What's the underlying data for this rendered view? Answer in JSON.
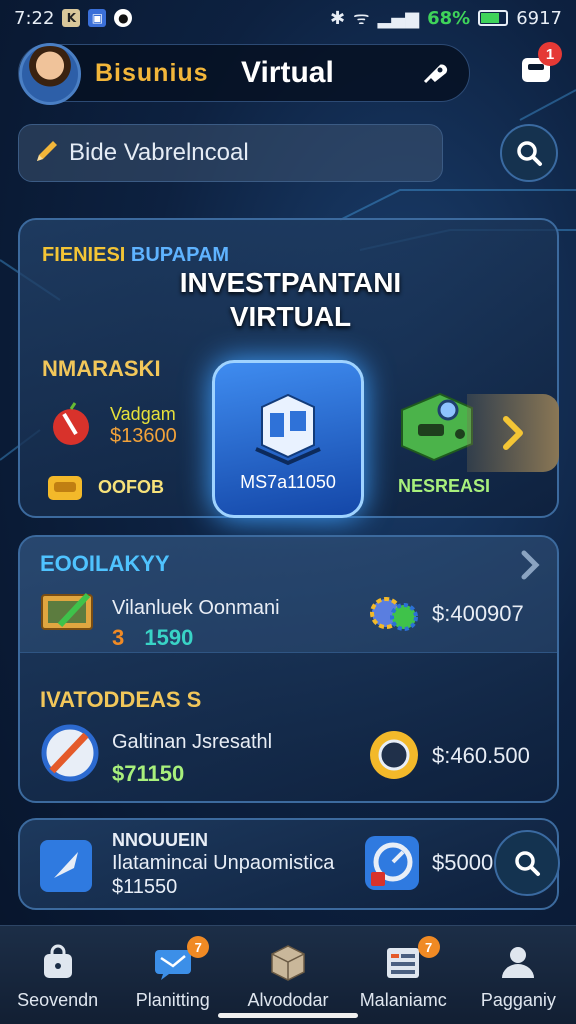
{
  "status": {
    "time": "7:22",
    "battery": "68%",
    "number": "6917"
  },
  "header": {
    "brand": "Bisunius",
    "title": "Virtual",
    "notif_count": "1"
  },
  "search": {
    "text": "Bide Vabrelncoal"
  },
  "hero": {
    "tag_a": "FIENIESI",
    "tag_b": "BUPAPAM",
    "title_line1": "INVESTPANTANI",
    "title_line2": "VIRTUAL",
    "label": "NMARASKI",
    "item1_name": "Vadgam",
    "item1_value": "$13600",
    "item2_name": "OOFOB",
    "center_label": "MS7a11050",
    "right_label": "NESREASI"
  },
  "list": {
    "section1": "EOOILAKYY",
    "row1_name": "Vilanluek Oonmani",
    "row1_value_a": "3",
    "row1_value_b": "1590",
    "row1_amount": "$:400907",
    "section2": "IVATODDEAS S",
    "row2_name": "Galtinan Jsresathl",
    "row2_value": "$71150",
    "row2_amount": "$:460.500"
  },
  "bottom_card": {
    "title": "NNOUUEIN",
    "subtitle": "Ilatamincai Unpaomistica",
    "value": "$11550",
    "amount": "$5000"
  },
  "nav": [
    {
      "label": "Seovendn",
      "icon": "bag-icon",
      "badge": ""
    },
    {
      "label": "Planitting",
      "icon": "chat-icon",
      "badge": "7"
    },
    {
      "label": "Alvododar",
      "icon": "box-icon",
      "badge": ""
    },
    {
      "label": "Malaniamc",
      "icon": "list-icon",
      "badge": "7"
    },
    {
      "label": "Pagganiy",
      "icon": "profile-icon",
      "badge": ""
    }
  ],
  "colors": {
    "accent_gold": "#f2b63a",
    "accent_blue": "#3f8cf0",
    "success_green": "#a8f07c",
    "badge_red": "#e53935"
  }
}
